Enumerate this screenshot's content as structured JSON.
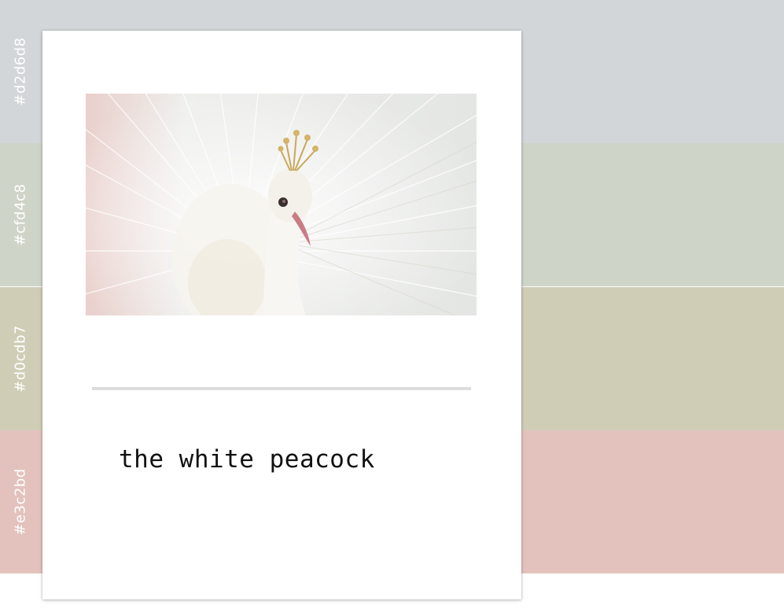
{
  "palette": [
    {
      "hex": "#d2d6d8",
      "label": "#d2d6d8"
    },
    {
      "hex": "#cfd4c8",
      "label": "#cfd4c8"
    },
    {
      "hex": "#d0cdb7",
      "label": "#d0cdb7"
    },
    {
      "hex": "#e3c2bd",
      "label": "#e3c2bd"
    }
  ],
  "card": {
    "caption": "the white peacock",
    "image_subject": "white-peacock-photo"
  }
}
